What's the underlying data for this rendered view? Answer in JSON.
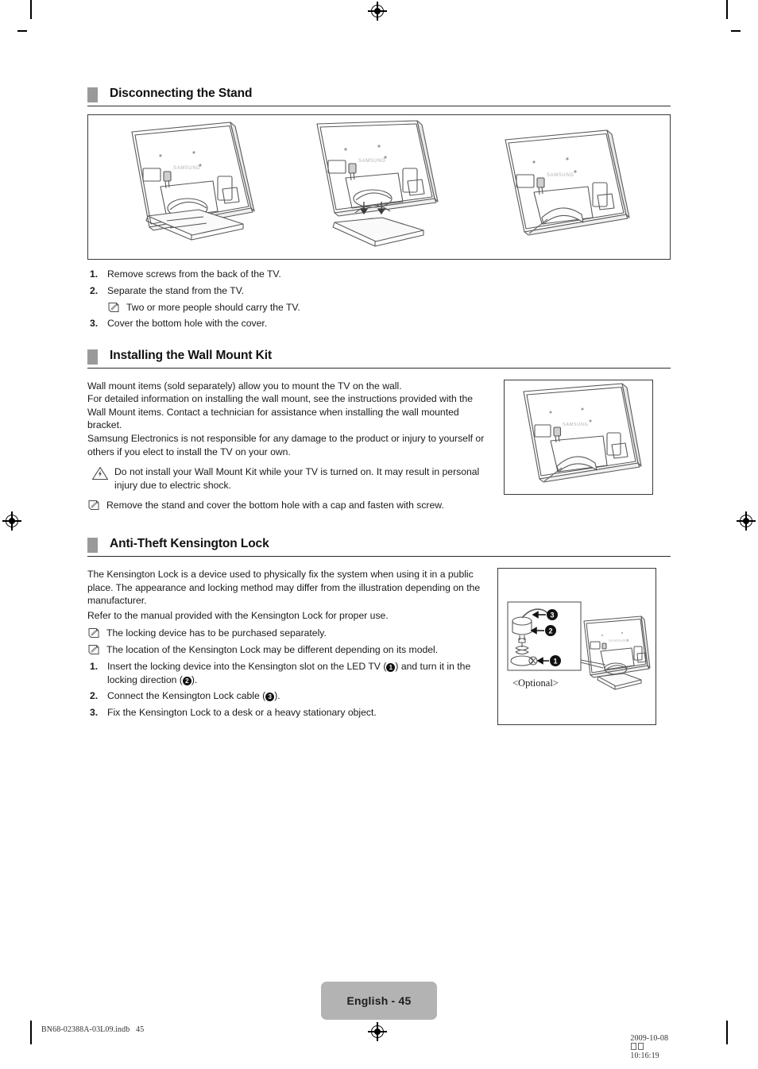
{
  "document": {
    "page_label": "English - 45",
    "footer_left": "BN68-02388A-03L09.indb   45",
    "footer_right_date": "2009-10-08",
    "footer_right_time": "10:16:19"
  },
  "sections": [
    {
      "id": "disconnecting-the-stand",
      "title": "Disconnecting the Stand",
      "figure": {
        "caption": "",
        "panels": [
          {
            "name": "tv-with-stand-screws",
            "logo": "SAMSUNG"
          },
          {
            "name": "tv-stand-separating",
            "logo": "SAMSUNG"
          },
          {
            "name": "tv-bottom-hole-cover",
            "logo": "SAMSUNG"
          }
        ]
      },
      "steps": [
        {
          "num": "1.",
          "text": "Remove screws from the back of the TV."
        },
        {
          "num": "2.",
          "text": "Separate the stand from the TV."
        },
        {
          "num": "3.",
          "text": "Cover the bottom hole with the cover."
        }
      ],
      "substep_note": {
        "icon": "note-icon",
        "text": "Two or more people should carry the TV."
      }
    },
    {
      "id": "installing-the-wall-mount-kit",
      "title": "Installing the Wall Mount Kit",
      "paragraphs": [
        "Wall mount items (sold separately) allow you to mount the TV on the wall.",
        "For detailed information on installing the wall mount, see the instructions provided with the Wall Mount items. Contact a technician for assistance when installing the wall mounted bracket.",
        "Samsung Electronics is not responsible for any damage to the product or injury to yourself or others if you elect to install the TV on your own."
      ],
      "warning": {
        "icon": "warning-triangle-icon",
        "text": "Do not install your Wall Mount Kit while your TV is turned on. It may result in personal injury due to electric shock."
      },
      "note": {
        "icon": "note-icon",
        "text": "Remove the stand and cover the bottom hole with a cap and fasten with screw."
      },
      "figure": {
        "name": "tv-rear-wall-mount",
        "logo": "SAMSUNG"
      }
    },
    {
      "id": "anti-theft-kensington-lock",
      "title": "Anti-Theft Kensington Lock",
      "paragraphs": [
        "The Kensington Lock is a device used to physically fix the system when using it in a public place. The appearance and locking method may differ from the illustration depending on the manufacturer.",
        "Refer to the manual provided with the Kensington Lock for proper use."
      ],
      "notes": [
        {
          "icon": "note-icon",
          "text": "The locking device has to be purchased separately."
        },
        {
          "icon": "note-icon",
          "text": "The location of the Kensington Lock may be different depending on its model."
        }
      ],
      "steps": [
        {
          "num": "1.",
          "parts": [
            "Insert the locking device into the Kensington slot on the LED TV (",
            "1",
            ") and turn it in the locking direction (",
            "2",
            ")."
          ]
        },
        {
          "num": "2.",
          "parts": [
            "Connect the Kensington Lock cable (",
            "3",
            ")."
          ]
        },
        {
          "num": "3.",
          "parts": [
            "Fix the Kensington Lock to a desk or a heavy stationary object."
          ]
        }
      ],
      "figure": {
        "name": "kensington-lock-diagram",
        "optional_caption": "<Optional>",
        "callouts": [
          "1",
          "2",
          "3"
        ],
        "logo": "SAMSUNG"
      }
    }
  ],
  "colors": {
    "heading_bar": "#9a9a9a",
    "page_badge": "#b3b3b3",
    "rule": "#2b2b2b",
    "text": "#1a1a1a"
  }
}
